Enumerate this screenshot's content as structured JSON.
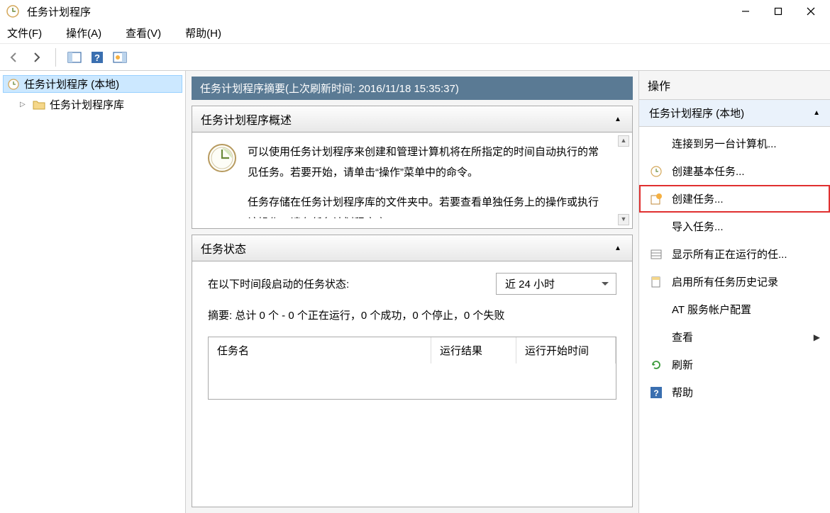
{
  "window": {
    "title": "任务计划程序"
  },
  "menubar": {
    "file": "文件(F)",
    "action": "操作(A)",
    "view": "查看(V)",
    "help": "帮助(H)"
  },
  "tree": {
    "root": "任务计划程序 (本地)",
    "library": "任务计划程序库"
  },
  "summary": {
    "header": "任务计划程序摘要(上次刷新时间: 2016/11/18 15:35:37)",
    "overview_title": "任务计划程序概述",
    "overview_text1": "可以使用任务计划程序来创建和管理计算机将在所指定的时间自动执行的常见任务。若要开始，请单击“操作”菜单中的命令。",
    "overview_text2": "任务存储在任务计划程序库的文件夹中。若要查看单独任务上的操作或执行该操作，请在任务计划程序库",
    "status_title": "任务状态",
    "status_period_label": "在以下时间段启动的任务状态:",
    "status_period_value": "近 24 小时",
    "status_summary": "摘要: 总计 0 个 - 0 个正在运行，0 个成功，0 个停止，0 个失败",
    "table": {
      "col_name": "任务名",
      "col_result": "运行结果",
      "col_start": "运行开始时间"
    }
  },
  "actions": {
    "panel_title": "操作",
    "section_title": "任务计划程序 (本地)",
    "items": {
      "connect": "连接到另一台计算机...",
      "create_basic": "创建基本任务...",
      "create_task": "创建任务...",
      "import": "导入任务...",
      "show_running": "显示所有正在运行的任...",
      "enable_history": "启用所有任务历史记录",
      "at_config": "AT 服务帐户配置",
      "view": "查看",
      "refresh": "刷新",
      "help": "帮助"
    }
  }
}
